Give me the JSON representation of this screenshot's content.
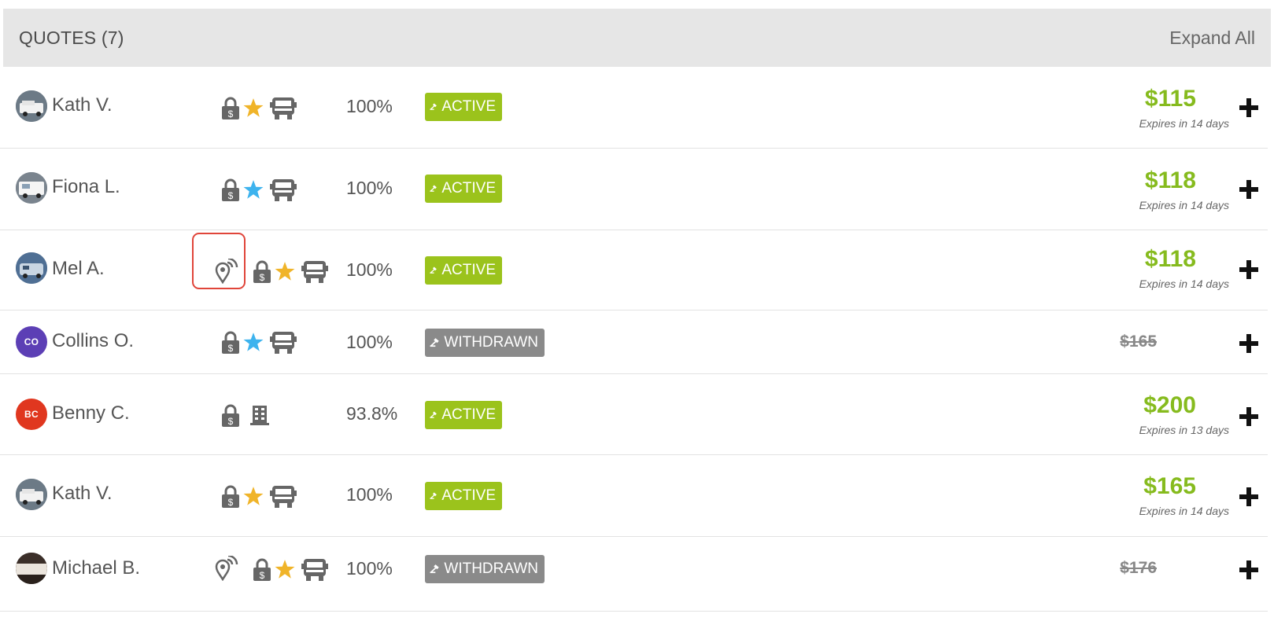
{
  "header": {
    "title": "QUOTES (7)",
    "expand_label": "Expand All"
  },
  "quotes": [
    {
      "name": "Kath V.",
      "initials": "",
      "avatar_color": "#5a6a78",
      "badges": [
        "lock-dollar-icon",
        "star-gold-icon",
        "bus-icon"
      ],
      "percent": "100%",
      "status": "ACTIVE",
      "price": "$115",
      "expires": "Expires in 14 days"
    },
    {
      "name": "Fiona L.",
      "initials": "",
      "avatar_color": "#6b7580",
      "badges": [
        "lock-dollar-icon",
        "star-blue-icon",
        "bus-icon"
      ],
      "percent": "100%",
      "status": "ACTIVE",
      "price": "$118",
      "expires": "Expires in 14 days"
    },
    {
      "name": "Mel A.",
      "initials": "",
      "avatar_color": "#4d6a8a",
      "badges": [
        "location-signal-icon",
        "lock-dollar-icon",
        "star-gold-icon",
        "bus-icon"
      ],
      "percent": "100%",
      "status": "ACTIVE",
      "price": "$118",
      "expires": "Expires in 14 days"
    },
    {
      "name": "Collins O.",
      "initials": "CO",
      "avatar_color": "#5c3fb5",
      "badges": [
        "lock-dollar-icon",
        "star-blue-icon",
        "bus-icon"
      ],
      "percent": "100%",
      "status": "WITHDRAWN",
      "price": "$165",
      "expires": ""
    },
    {
      "name": "Benny C.",
      "initials": "BC",
      "avatar_color": "#e0371f",
      "badges": [
        "lock-dollar-icon",
        "building-icon"
      ],
      "percent": "93.8%",
      "status": "ACTIVE",
      "price": "$200",
      "expires": "Expires in 13 days"
    },
    {
      "name": "Kath V.",
      "initials": "",
      "avatar_color": "#5a6a78",
      "badges": [
        "lock-dollar-icon",
        "star-gold-icon",
        "bus-icon"
      ],
      "percent": "100%",
      "status": "ACTIVE",
      "price": "$165",
      "expires": "Expires in 14 days"
    },
    {
      "name": "Michael B.",
      "initials": "",
      "avatar_color": "#3a2e28",
      "badges": [
        "location-signal-icon",
        "lock-dollar-icon",
        "star-gold-icon",
        "bus-icon"
      ],
      "percent": "100%",
      "status": "WITHDRAWN",
      "price": "$176",
      "expires": ""
    }
  ],
  "colors": {
    "active": "#9bc31c",
    "withdrawn": "#8a8a8a",
    "price": "#86bb1e",
    "star_gold": "#f0b429",
    "star_blue": "#3db3ee",
    "highlight": "#e0453a"
  }
}
